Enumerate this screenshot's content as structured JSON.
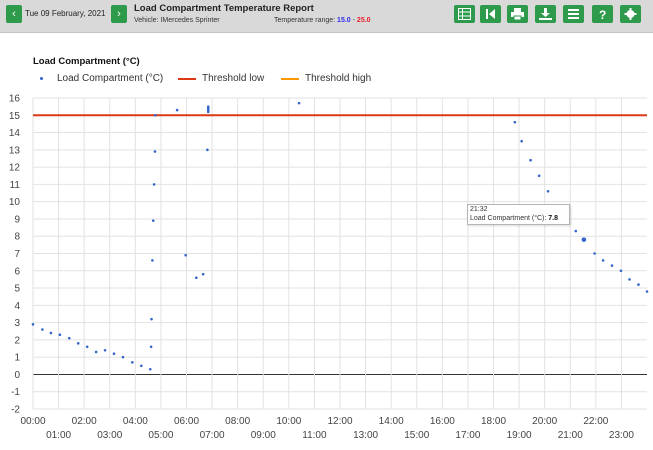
{
  "toolbar": {
    "prev_glyph": "‹",
    "next_glyph": "›",
    "date": "Tue 09 February, 2021",
    "title": "Load Compartment Temperature Report",
    "vehicle": "Vehicle: IMercedes Sprinter",
    "temp_range_label": "Temperature range:",
    "temp_low": "15.0",
    "temp_sep": "-",
    "temp_high": "25.0",
    "buttons": [
      "table-icon",
      "skip-back-icon",
      "print-icon",
      "download-icon",
      "menu-icon",
      "help-icon",
      "gear-icon"
    ]
  },
  "tooltip": {
    "time": "21:32",
    "label": "Load Compartment (°C):",
    "value": "7.8"
  },
  "chart_data": {
    "type": "scatter",
    "title": "Load Compartment (°C)",
    "xlabel": "",
    "ylabel": "",
    "xlim": [
      "00:00",
      "24:00"
    ],
    "ylim": [
      -2,
      16
    ],
    "y_ticks": [
      -2,
      -1,
      0,
      1,
      2,
      3,
      4,
      5,
      6,
      7,
      8,
      9,
      10,
      11,
      12,
      13,
      14,
      15,
      16
    ],
    "x_ticks_top": [
      "00:00",
      "02:00",
      "04:00",
      "06:00",
      "08:00",
      "10:00",
      "12:00",
      "14:00",
      "16:00",
      "18:00",
      "20:00",
      "22:00"
    ],
    "x_ticks_bottom": [
      "01:00",
      "03:00",
      "05:00",
      "07:00",
      "09:00",
      "11:00",
      "13:00",
      "15:00",
      "17:00",
      "19:00",
      "21:00",
      "23:00"
    ],
    "grid": true,
    "legend_position": "top-left",
    "series": [
      {
        "name": "Load Compartment (°C)",
        "color": "#3366cc",
        "points": [
          [
            "00:00",
            2.9
          ],
          [
            "00:22",
            2.6
          ],
          [
            "00:42",
            2.4
          ],
          [
            "01:03",
            2.3
          ],
          [
            "01:25",
            2.1
          ],
          [
            "01:46",
            1.8
          ],
          [
            "02:07",
            1.6
          ],
          [
            "02:28",
            1.3
          ],
          [
            "02:49",
            1.4
          ],
          [
            "03:10",
            1.2
          ],
          [
            "03:31",
            1.0
          ],
          [
            "03:53",
            0.7
          ],
          [
            "04:14",
            0.5
          ],
          [
            "04:35",
            0.3
          ],
          [
            "04:37",
            1.6
          ],
          [
            "04:38",
            3.2
          ],
          [
            "04:40",
            6.6
          ],
          [
            "04:42",
            8.9
          ],
          [
            "04:44",
            11.0
          ],
          [
            "04:46",
            12.9
          ],
          [
            "04:47",
            15.0
          ],
          [
            "05:38",
            15.3
          ],
          [
            "05:58",
            6.9
          ],
          [
            "06:23",
            5.6
          ],
          [
            "06:39",
            5.8
          ],
          [
            "06:49",
            13.0
          ],
          [
            "06:51",
            15.2
          ],
          [
            "06:51",
            15.3
          ],
          [
            "06:51",
            15.4
          ],
          [
            "06:51",
            15.5
          ],
          [
            "10:24",
            15.7
          ],
          [
            "18:50",
            14.6
          ],
          [
            "19:06",
            13.5
          ],
          [
            "19:27",
            12.4
          ],
          [
            "19:47",
            11.5
          ],
          [
            "20:08",
            10.6
          ],
          [
            "21:13",
            8.3
          ],
          [
            "21:32",
            7.8
          ],
          [
            "21:57",
            7.0
          ],
          [
            "22:17",
            6.6
          ],
          [
            "22:38",
            6.3
          ],
          [
            "22:59",
            6.0
          ],
          [
            "23:19",
            5.5
          ],
          [
            "23:40",
            5.2
          ],
          [
            "24:00",
            4.8
          ]
        ]
      },
      {
        "name": "Threshold low",
        "color": "#dc3912",
        "value": 15.0
      },
      {
        "name": "Threshold high",
        "color": "#ff9900",
        "value": 25.0
      }
    ]
  }
}
